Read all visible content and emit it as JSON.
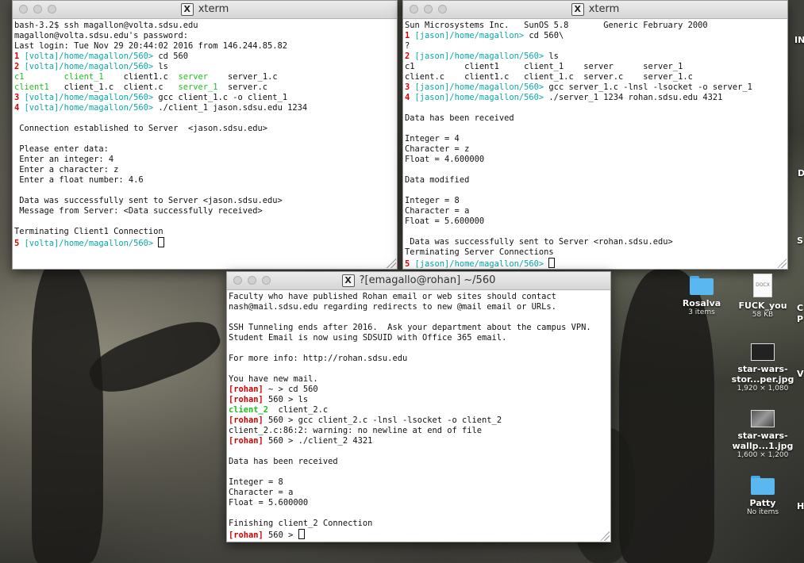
{
  "windows": {
    "xterm_left": {
      "title": "xterm",
      "lines": [
        [
          {
            "t": "bash-3.2$ ssh magallon@volta.sdsu.edu"
          }
        ],
        [
          {
            "t": "magallon@volta.sdsu.edu's password:"
          }
        ],
        [
          {
            "t": "Last login: Tue Nov 29 20:44:02 2016 from 146.244.85.82"
          }
        ],
        [
          {
            "t": "1",
            "c": "n"
          },
          {
            "t": " [volta]/home/magallon/560>",
            "c": "p"
          },
          {
            "t": " cd 560"
          }
        ],
        [
          {
            "t": "2",
            "c": "n"
          },
          {
            "t": " [volta]/home/magallon/560>",
            "c": "p"
          },
          {
            "t": " ls"
          }
        ],
        [
          {
            "t": "c1",
            "c": "g"
          },
          {
            "t": "        "
          },
          {
            "t": "client_1",
            "c": "g"
          },
          {
            "t": "    client1.c  "
          },
          {
            "t": "server",
            "c": "g"
          },
          {
            "t": "    server_1.c"
          }
        ],
        [
          {
            "t": "client1",
            "c": "g"
          },
          {
            "t": "   client_1.c  client.c   "
          },
          {
            "t": "server_1",
            "c": "g"
          },
          {
            "t": "  server.c"
          }
        ],
        [
          {
            "t": "3",
            "c": "n"
          },
          {
            "t": " [volta]/home/magallon/560>",
            "c": "p"
          },
          {
            "t": " gcc client_1.c -o client_1"
          }
        ],
        [
          {
            "t": "4",
            "c": "n"
          },
          {
            "t": " [volta]/home/magallon/560>",
            "c": "p"
          },
          {
            "t": " ./client_1 jason.sdsu.edu 1234"
          }
        ],
        [
          {
            "t": ""
          }
        ],
        [
          {
            "t": " Connection established to Server  <jason.sdsu.edu>"
          }
        ],
        [
          {
            "t": ""
          }
        ],
        [
          {
            "t": " Please enter data:"
          }
        ],
        [
          {
            "t": " Enter an integer: 4"
          }
        ],
        [
          {
            "t": " Enter a character: z"
          }
        ],
        [
          {
            "t": " Enter a float number: 4.6"
          }
        ],
        [
          {
            "t": ""
          }
        ],
        [
          {
            "t": " Data was successfully sent to Server <jason.sdsu.edu>"
          }
        ],
        [
          {
            "t": " Message from Server: <Data successfully received>"
          }
        ],
        [
          {
            "t": ""
          }
        ],
        [
          {
            "t": "Terminating Client1 Connection"
          }
        ],
        [
          {
            "t": "5",
            "c": "n"
          },
          {
            "t": " [volta]/home/magallon/560>",
            "c": "p"
          },
          {
            "t": " "
          },
          {
            "cursor": true
          }
        ]
      ]
    },
    "xterm_right": {
      "title": "xterm",
      "lines": [
        [
          {
            "t": "Sun Microsystems Inc.   SunOS 5.8       Generic February 2000"
          }
        ],
        [
          {
            "t": "1",
            "c": "n"
          },
          {
            "t": " [jason]/home/magallon>",
            "c": "p"
          },
          {
            "t": " cd 560\\"
          }
        ],
        [
          {
            "t": "?"
          }
        ],
        [
          {
            "t": "2",
            "c": "n"
          },
          {
            "t": " [jason]/home/magallon/560>",
            "c": "p"
          },
          {
            "t": " ls"
          }
        ],
        [
          {
            "t": "c1          client1     client_1    server      server_1"
          }
        ],
        [
          {
            "t": "client.c    client1.c   client_1.c  server.c    server_1.c"
          }
        ],
        [
          {
            "t": "3",
            "c": "n"
          },
          {
            "t": " [jason]/home/magallon/560>",
            "c": "p"
          },
          {
            "t": " gcc server_1.c -lnsl -lsocket -o server_1"
          }
        ],
        [
          {
            "t": "4",
            "c": "n"
          },
          {
            "t": " [jason]/home/magallon/560>",
            "c": "p"
          },
          {
            "t": " ./server_1 1234 rohan.sdsu.edu 4321"
          }
        ],
        [
          {
            "t": ""
          }
        ],
        [
          {
            "t": "Data has been received"
          }
        ],
        [
          {
            "t": ""
          }
        ],
        [
          {
            "t": "Integer = 4"
          }
        ],
        [
          {
            "t": "Character = z"
          }
        ],
        [
          {
            "t": "Float = 4.600000"
          }
        ],
        [
          {
            "t": ""
          }
        ],
        [
          {
            "t": "Data modified"
          }
        ],
        [
          {
            "t": ""
          }
        ],
        [
          {
            "t": "Integer = 8"
          }
        ],
        [
          {
            "t": "Character = a"
          }
        ],
        [
          {
            "t": "Float = 5.600000"
          }
        ],
        [
          {
            "t": ""
          }
        ],
        [
          {
            "t": " Data was successfully sent to Server <rohan.sdsu.edu>"
          }
        ],
        [
          {
            "t": "Terminating Server Connections"
          }
        ],
        [
          {
            "t": "5",
            "c": "n"
          },
          {
            "t": " [jason]/home/magallon/560>",
            "c": "p"
          },
          {
            "t": " "
          },
          {
            "cursor": true
          }
        ]
      ]
    },
    "xterm_rohan": {
      "title": "?[emagallo@rohan] ~/560",
      "lines": [
        [
          {
            "t": "Faculty who have published Rohan email or web sites should contact"
          }
        ],
        [
          {
            "t": "nash@mail.sdsu.edu regarding redirects to new @mail email or URLs."
          }
        ],
        [
          {
            "t": ""
          }
        ],
        [
          {
            "t": "SSH Tunneling ends after 2016.  Ask your department about the campus VPN."
          }
        ],
        [
          {
            "t": "Student Email is now using SDSUID with Office 365 email."
          }
        ],
        [
          {
            "t": ""
          }
        ],
        [
          {
            "t": "For more info: http://rohan.sdsu.edu"
          }
        ],
        [
          {
            "t": ""
          }
        ],
        [
          {
            "t": "You have new mail."
          }
        ],
        [
          {
            "t": "[rohan]",
            "c": "rh"
          },
          {
            "t": " ~ > cd 560"
          }
        ],
        [
          {
            "t": "[rohan]",
            "c": "rh"
          },
          {
            "t": " 560 > ls"
          }
        ],
        [
          {
            "t": "client_2",
            "c": "gb"
          },
          {
            "t": "  client_2.c"
          }
        ],
        [
          {
            "t": "[rohan]",
            "c": "rh"
          },
          {
            "t": " 560 > gcc client_2.c -lnsl -lsocket -o client_2"
          }
        ],
        [
          {
            "t": "client_2.c:86:2: warning: no newline at end of file"
          }
        ],
        [
          {
            "t": "[rohan]",
            "c": "rh"
          },
          {
            "t": " 560 > ./client_2 4321"
          }
        ],
        [
          {
            "t": ""
          }
        ],
        [
          {
            "t": "Data has been received"
          }
        ],
        [
          {
            "t": ""
          }
        ],
        [
          {
            "t": "Integer = 8"
          }
        ],
        [
          {
            "t": "Character = a"
          }
        ],
        [
          {
            "t": "Float = 5.600000"
          }
        ],
        [
          {
            "t": ""
          }
        ],
        [
          {
            "t": "Finishing client_2 Connection"
          }
        ],
        [
          {
            "t": "[rohan]",
            "c": "rh"
          },
          {
            "t": " 560 > "
          },
          {
            "cursor": true
          }
        ]
      ]
    }
  },
  "desktop": {
    "items": [
      {
        "name": "Rosalva",
        "sub": "3 items",
        "icon": "folder-icon"
      },
      {
        "name": "FUCK_you",
        "sub": "58 KB",
        "icon": "docx-icon",
        "badge": "DOCX"
      },
      {
        "name": "star-wars-\nstor...per.jpg",
        "sub": "1,920 × 1,080",
        "icon": "image-thumbnail-icon"
      },
      {
        "name": "star-wars-\nwallp...1.jpg",
        "sub": "1,600 × 1,200",
        "icon": "image-thumbnail-icon"
      },
      {
        "name": "Patty",
        "sub": "No items",
        "icon": "folder-icon"
      }
    ],
    "edge_fragments": [
      "IN",
      "D",
      "S",
      "C",
      "P",
      "V",
      "H"
    ]
  },
  "colors": {
    "prompt_number": "#e00000",
    "prompt_path": "#0aa8a8",
    "executable": "#1fbf1f",
    "rohan_prompt": "#d00000",
    "folder": "#5bb7f0"
  }
}
